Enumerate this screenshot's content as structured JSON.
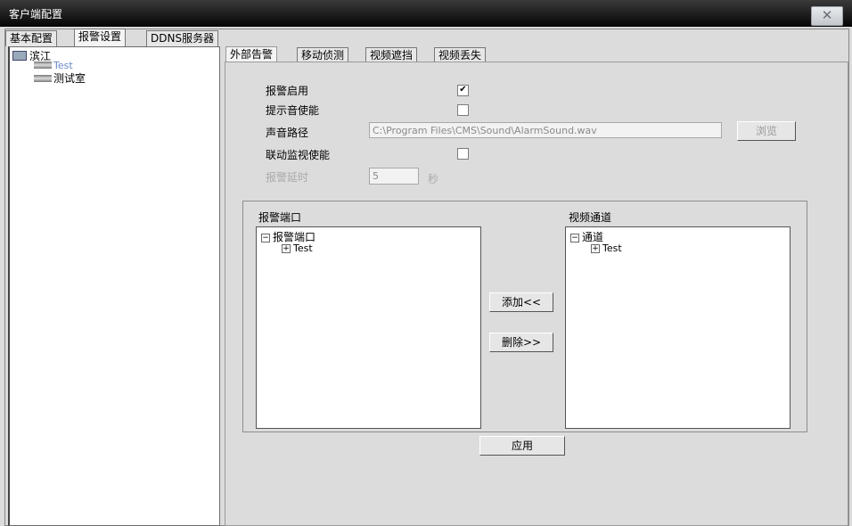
{
  "window": {
    "title": "客户端配置",
    "close_symbol": "✕"
  },
  "main_tabs": [
    "基本配置",
    "报警设置",
    "DDNS服务器"
  ],
  "tree": {
    "root": "滨江",
    "children": [
      "Test",
      "测试室"
    ]
  },
  "sub_tabs": [
    "外部告警",
    "移动侦测",
    "视频遮挡",
    "视频丢失"
  ],
  "form": {
    "alarm_enable": {
      "label": "报警启用",
      "checked": "✔"
    },
    "sound_enable": {
      "label": "提示音使能",
      "checked": ""
    },
    "sound_path": {
      "label": "声音路径",
      "value": "C:\\Program Files\\CMS\\Sound\\AlarmSound.wav"
    },
    "browse_label": "浏览",
    "linkage_enable": {
      "label": "联动监视使能",
      "checked": ""
    },
    "alarm_delay": {
      "label": "报警延时",
      "value": "5",
      "unit": "秒"
    }
  },
  "alarm_ports": {
    "title": "报警端口",
    "root": "报警端口",
    "child": "Test"
  },
  "video_channels": {
    "title": "视频通道",
    "root": "通道",
    "child": "Test"
  },
  "buttons": {
    "add": "添加<<",
    "delete": "删除>>",
    "apply": "应用"
  }
}
